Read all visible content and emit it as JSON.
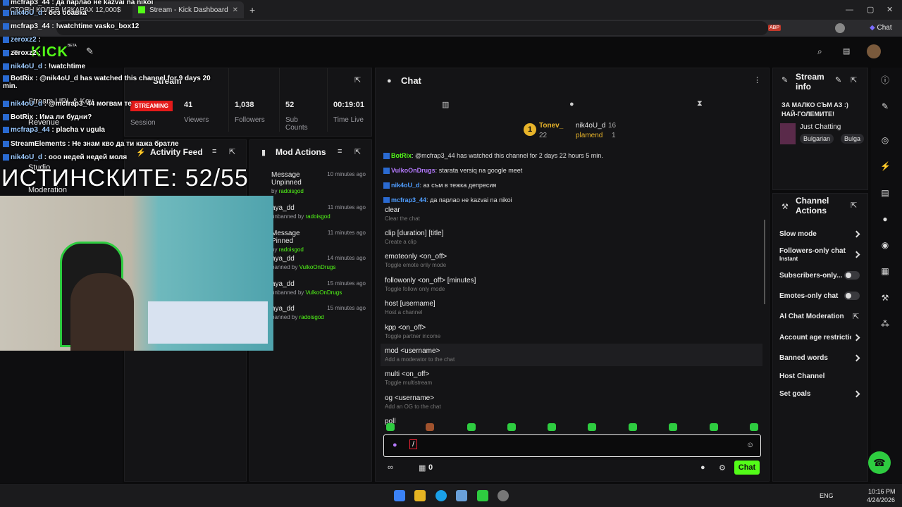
{
  "browser": {
    "tab1": "СТОЯН КОЛЕВ ИЗКАРАХ 12,000$",
    "tab2": "Stream - Kick Dashboard",
    "profile": "Chat",
    "ext_badge": "ABP"
  },
  "header": {
    "logo": "KICK",
    "beta": "BETA"
  },
  "stream_panel": {
    "title": "Stream",
    "status": "STREAMING",
    "session": "Session",
    "stats": [
      {
        "value": "41",
        "label": "Viewers"
      },
      {
        "value": "1,038",
        "label": "Followers"
      },
      {
        "value": "52",
        "label": "Sub Counts"
      },
      {
        "value": "00:19:01",
        "label": "Time Live"
      }
    ]
  },
  "nav": {
    "stream_url": "Stream URL & Key",
    "revenue": "Revenue",
    "studio": "Studio",
    "moderation": "Moderation"
  },
  "activity": {
    "title": "Activity Feed"
  },
  "mod_actions": {
    "title": "Mod Actions",
    "items": [
      {
        "title": "Message Unpinned",
        "by_prefix": "by",
        "by": "radoisgod",
        "time": "10 minutes ago"
      },
      {
        "title": "aya_dd",
        "by_prefix": "unbanned by",
        "by": "radoisgod",
        "time": "11 minutes ago"
      },
      {
        "title": "Message Pinned",
        "by_prefix": "by",
        "by": "radoisgod",
        "time": "11 minutes ago"
      },
      {
        "title": "aya_dd",
        "by_prefix": "banned by",
        "by": "VulkoOnDrugs",
        "time": "14 minutes ago"
      },
      {
        "title": "aya_dd",
        "by_prefix": "unbanned by",
        "by": "VulkoOnDrugs",
        "time": "15 minutes ago"
      },
      {
        "title": "aya_dd",
        "by_prefix": "banned by",
        "by": "radoisgod",
        "time": "15 minutes ago"
      }
    ]
  },
  "chat": {
    "title": "Chat",
    "top1_name": "Tonev_",
    "top1_count": "22",
    "top2_name": "nik4oU_d",
    "top2_count": "16",
    "top3_name": "plamend",
    "top3_count": "1",
    "messages": [
      {
        "user": "BotRix",
        "text": "@mcfrap3_44 has watched this channel for 2 days 22 hours 5 min.",
        "color": "#53fc18"
      },
      {
        "user": "VulkoOnDrugs",
        "text": "starata versiq na google meet",
        "color": "#b57bff"
      },
      {
        "user": "nik4oU_d",
        "text": "аз съм в тежка депресия",
        "color": "#4f9dff"
      },
      {
        "user": "mcfrap3_44",
        "text": "да парлао не kazvai na nikoi",
        "color": "#4f9dff"
      }
    ],
    "commands": [
      {
        "n": "clear",
        "d": "Clear the chat"
      },
      {
        "n": "clip [duration] [title]",
        "d": "Create a clip"
      },
      {
        "n": "emoteonly <on_off>",
        "d": "Toggle emote only mode"
      },
      {
        "n": "followonly <on_off> [minutes]",
        "d": "Toggle follow only mode"
      },
      {
        "n": "host [username]",
        "d": "Host a channel"
      },
      {
        "n": "kpp <on_off>",
        "d": "Toggle partner income"
      },
      {
        "n": "mod <username>",
        "d": "Add a moderator to the chat"
      },
      {
        "n": "multi <on_off>",
        "d": "Toggle multistream"
      },
      {
        "n": "og <username>",
        "d": "Add an OG to the chat"
      },
      {
        "n": "poll",
        "d": ""
      }
    ],
    "input_value": "/",
    "count": "0",
    "send": "Chat"
  },
  "stream_info": {
    "title": "Stream info",
    "headline": "ЗА МАЛКО СЪМ АЗ :) НАЙ-ГОЛЕМИТЕ!",
    "category": "Just Chatting",
    "tags": [
      "Bulgarian",
      "Bulga"
    ]
  },
  "channel_actions": {
    "title": "Channel Actions",
    "items": {
      "slow": "Slow mode",
      "followers": "Followers-only chat",
      "followers_sub": "Instant",
      "subs": "Subscribers-only...",
      "emotes": "Emotes-only chat",
      "ai": "AI Chat Moderation",
      "age": "Account age restrictio",
      "banned": "Banned words",
      "host": "Host Channel",
      "goals": "Set goals"
    }
  },
  "overlay": {
    "big": "ИСТИНСКИТЕ: 52/55",
    "lines": [
      {
        "u": "mcfrap3_44",
        "t": "да парлао не kazvai na nikoi"
      },
      {
        "u": "nik4oU_d",
        "t": "без обавка"
      },
      {
        "u": "mcfrap3_44",
        "t": "!watchtime vasko_box12"
      },
      {
        "u": "zeroxz2",
        "t": ""
      },
      {
        "u": "zeroxz2",
        "t": ""
      },
      {
        "u": "nik4oU_d",
        "t": "!watchtime"
      },
      {
        "u": "BotRix",
        "t": "@nik4oU_d has watched this channel for 9 days 20 min."
      },
      {
        "u": "nik4oU_d",
        "t": "@mcfrap3_44 могвам те"
      },
      {
        "u": "BotRix",
        "t": "Има ли будни?"
      },
      {
        "u": "mcfrap3_44",
        "t": "placha v ugula"
      },
      {
        "u": "StreamElements",
        "t": "Не знам кво да ти кажа братле"
      },
      {
        "u": "nik4oU_d",
        "t": "ооо недей недей моля"
      }
    ]
  },
  "taskbar": {
    "lang": "ENG",
    "time": "10:16 PM",
    "date": "4/24/2026"
  }
}
